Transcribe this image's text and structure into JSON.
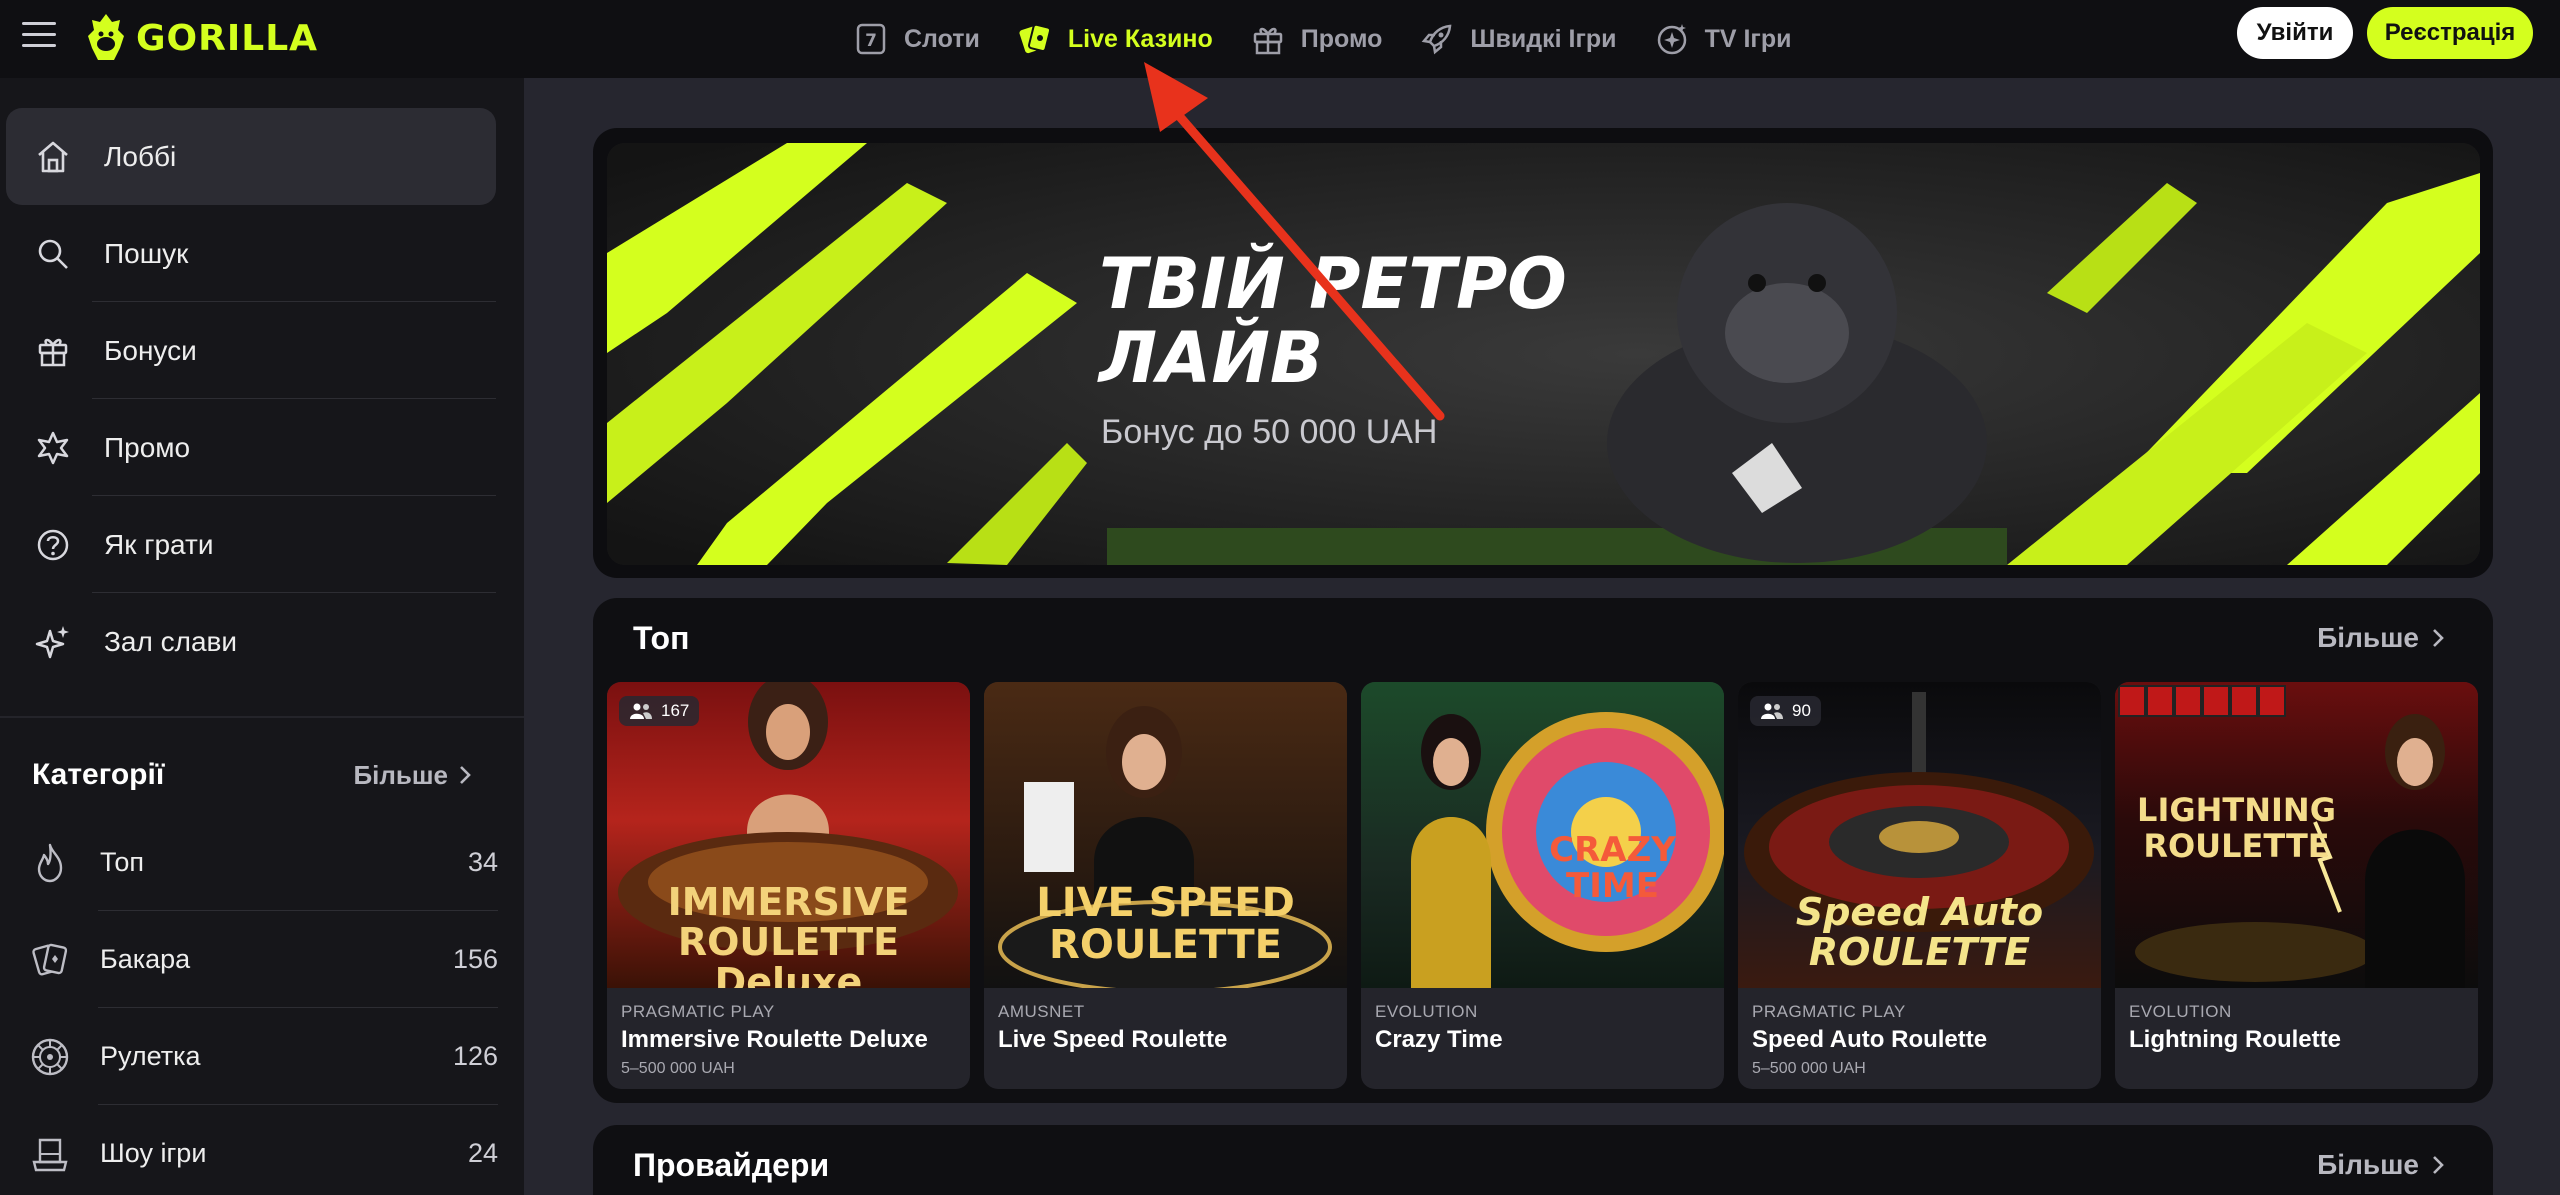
{
  "header": {
    "logo": "GORILLA",
    "nav": [
      {
        "label": "Слоти",
        "icon": "slot-icon"
      },
      {
        "label": "Live Казино",
        "icon": "cards-icon",
        "active": true
      },
      {
        "label": "Промо",
        "icon": "gift-icon"
      },
      {
        "label": "Швидкі Ігри",
        "icon": "rocket-icon"
      },
      {
        "label": "TV Ігри",
        "icon": "tv-star-icon"
      }
    ],
    "login_label": "Увійти",
    "register_label": "Реєстрація"
  },
  "sidebar": {
    "items": [
      {
        "label": "Лоббі",
        "icon": "home-icon"
      },
      {
        "label": "Пошук",
        "icon": "search-icon"
      },
      {
        "label": "Бонуси",
        "icon": "gift-icon"
      },
      {
        "label": "Промо",
        "icon": "star-burst-icon"
      },
      {
        "label": "Як грати",
        "icon": "question-icon"
      },
      {
        "label": "Зал слави",
        "icon": "sparkle-icon"
      }
    ],
    "categories_title": "Категорії",
    "categories_more": "Більше",
    "categories": [
      {
        "label": "Топ",
        "count": "34",
        "icon": "flame-icon"
      },
      {
        "label": "Бакара",
        "count": "156",
        "icon": "cards-icon"
      },
      {
        "label": "Рулетка",
        "count": "126",
        "icon": "roulette-icon"
      },
      {
        "label": "Шоу ігри",
        "count": "24",
        "icon": "hat-icon"
      }
    ]
  },
  "banner": {
    "title": "ТВІЙ РЕТРО ЛАЙВ",
    "subtitle": "Бонус до 50 000 UAH"
  },
  "top_section": {
    "title": "Топ",
    "more": "Більше",
    "games": [
      {
        "provider": "PRAGMATIC PLAY",
        "name": "Immersive Roulette Deluxe",
        "limit": "5–500 000 UAH",
        "players": "167",
        "art": "IMMERSIVE ROULETTE Deluxe"
      },
      {
        "provider": "AMUSNET",
        "name": "Live Speed Roulette",
        "limit": "",
        "players": "",
        "art": "LIVE SPEED ROULETTE"
      },
      {
        "provider": "EVOLUTION",
        "name": "Crazy Time",
        "limit": "",
        "players": "",
        "art": "CRAZY TIME"
      },
      {
        "provider": "PRAGMATIC PLAY",
        "name": "Speed Auto Roulette",
        "limit": "5–500 000 UAH",
        "players": "90",
        "art": "Speed Auto ROULETTE"
      },
      {
        "provider": "EVOLUTION",
        "name": "Lightning Roulette",
        "limit": "",
        "players": "",
        "art": "LIGHTNING ROULETTE"
      }
    ]
  },
  "providers_section": {
    "title": "Провайдери",
    "more": "Більше"
  },
  "colors": {
    "accent": "#d4ff1e",
    "annotation_arrow": "#e8321c"
  }
}
